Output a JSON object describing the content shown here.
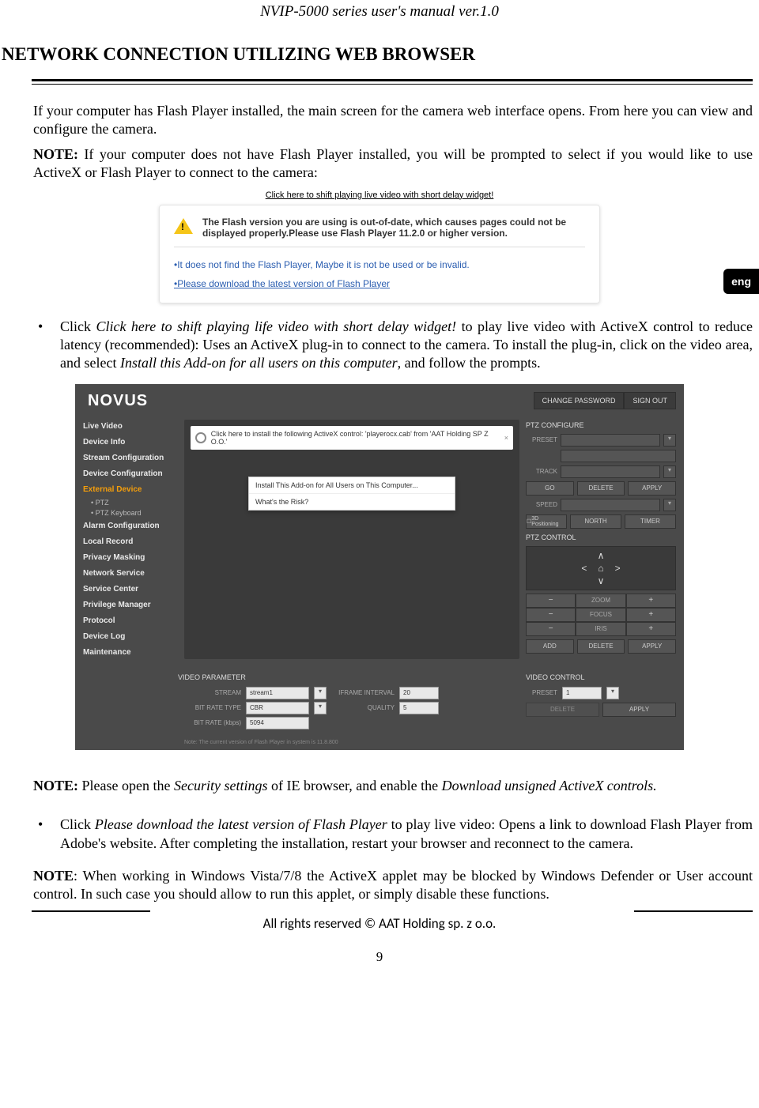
{
  "doc": {
    "header": "NVIP-5000 series  user's manual ver.1.0",
    "section_title": "NETWORK CONNECTION UTILIZING WEB BROWSER",
    "lang_tab": "eng",
    "copyright": "All rights reserved © AAT Holding sp. z o.o.",
    "page_number": "9"
  },
  "para": {
    "intro": "If your computer has Flash Player installed, the main screen for the camera web interface opens. From here you can view and configure the camera.",
    "note1_label": "NOTE:",
    "note1_text": " If your computer does not have Flash Player installed, you will be prompted to select if you would like to use ActiveX or Flash Player to connect to the camera:",
    "caption_link": "Click here to shift playing live video with short delay widget!",
    "bullet1_pre": "Click ",
    "bullet1_italic1": "Click here to shift playing life video with short delay widget!",
    "bullet1_mid": " to play live video with ActiveX control to reduce latency (recommended): Uses an ActiveX plug-in to connect to the camera. To install the plug-in, click on the video area, and select ",
    "bullet1_italic2": "Install this Add-on for all users on this computer",
    "bullet1_end": ", and follow the prompts.",
    "note2_label": "NOTE:",
    "note2_text_pre": " Please open the ",
    "note2_italic1": "Security settings",
    "note2_text_mid": " of IE browser, and enable the ",
    "note2_italic2": "Download unsigned ActiveX controls.",
    "bullet2_pre": "Click ",
    "bullet2_italic": "Please download the latest version of Flash Player",
    "bullet2_end": " to play live video: Opens a link to download Flash Player from Adobe's website. After completing the installation, restart your browser and reconnect to the camera.",
    "note3_label": "NOTE",
    "note3_text": ": When working in Windows Vista/7/8 the ActiveX applet may be blocked by Windows Defender or User account control. In such case you should allow to run this applet, or simply disable these functions."
  },
  "flashbox": {
    "warn": "The Flash version you are using is out-of-date, which causes pages could not be displayed properly.Please use Flash Player 11.2.0 or higher version.",
    "link1": "•It does not find the Flash Player, Maybe it is not be used or be invalid.",
    "link2": "•Please download the latest version of Flash Player"
  },
  "cam": {
    "logo": "NOVUS",
    "change_pw": "CHANGE PASSWORD",
    "sign_out": "SIGN OUT",
    "sidebar": [
      "Live Video",
      "Device Info",
      "Stream Configuration",
      "Device Configuration",
      "External Device",
      "• PTZ",
      "• PTZ Keyboard",
      "Alarm Configuration",
      "Local Record",
      "Privacy Masking",
      "Network Service",
      "Service Center",
      "Privilege Manager",
      "Protocol",
      "Device Log",
      "Maintenance"
    ],
    "install_bar": "Click here to install the following ActiveX control: 'playerocx.cab' from 'AAT Holding  SP Z O.O.'",
    "popup1": "Install This Add-on for All Users on This Computer...",
    "popup2": "What's the Risk?",
    "ptz_configure": "PTZ CONFIGURE",
    "preset": "PRESET",
    "track": "TRACK",
    "go": "GO",
    "delete": "DELETE",
    "apply": "APPLY",
    "speed": "SPEED",
    "pos3d": "3D Positioning",
    "north": "NORTH",
    "timer": "TIMER",
    "ptz_control": "PTZ CONTROL",
    "zoom": "ZOOM",
    "focus": "FOCUS",
    "iris": "IRIS",
    "add": "ADD",
    "video_parameter": "VIDEO PARAMETER",
    "stream": "STREAM",
    "stream_val": "stream1",
    "iframe": "IFRAME INTERVAL",
    "iframe_val": "20",
    "bitrate_type": "BIT RATE TYPE",
    "bitrate_type_val": "CBR",
    "quality": "QUALITY",
    "quality_val": "5",
    "bitrate": "BIT RATE (kbps)",
    "bitrate_val": "5094",
    "video_control": "VIDEO CONTROL",
    "vc_preset": "PRESET",
    "vc_preset_val": "1",
    "vc_delete": "DELETE",
    "vc_apply": "APPLY",
    "footnote": "Note: The current version of Flash Player in system is 11.8.800"
  }
}
